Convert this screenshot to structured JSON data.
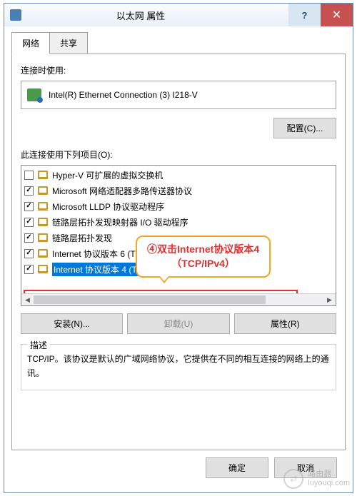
{
  "window": {
    "title": "以太网 属性",
    "help_symbol": "?",
    "close_symbol": "✕"
  },
  "tabs": {
    "active": "网络",
    "inactive": "共享"
  },
  "section": {
    "connect_with_label": "连接时使用:",
    "adapter_name": "Intel(R) Ethernet Connection (3) I218-V",
    "configure_btn": "配置(C)...",
    "items_label": "此连接使用下列项目(O):"
  },
  "list": [
    {
      "checked": false,
      "text": "Hyper-V 可扩展的虚拟交换机",
      "selected": false
    },
    {
      "checked": true,
      "text": "Microsoft 网络适配器多路传送器协议",
      "selected": false
    },
    {
      "checked": true,
      "text": "Microsoft LLDP 协议驱动程序",
      "selected": false
    },
    {
      "checked": true,
      "text": "链路层拓扑发现映射器 I/O 驱动程序",
      "selected": false
    },
    {
      "checked": true,
      "text": "链路层拓扑发现",
      "selected": false,
      "clipped": true
    },
    {
      "checked": true,
      "text": "Internet 协议版本 6 (TCP/IPv6)",
      "selected": false,
      "partial": true
    },
    {
      "checked": true,
      "text": "Internet 协议版本 4 (TCP/IPv4)",
      "selected": true
    }
  ],
  "buttons": {
    "install": "安装(N)...",
    "uninstall": "卸载(U)",
    "properties": "属性(R)"
  },
  "description": {
    "label": "描述",
    "text": "TCP/IP。该协议是默认的广域网络协议，它提供在不同的相互连接的网络上的通讯。"
  },
  "footer": {
    "ok": "确定",
    "cancel": "取消"
  },
  "callout": {
    "line1": "④双击Internet协议版本4",
    "line2": "（TCP/IPv4）"
  },
  "watermark": {
    "brand": "路由器",
    "url": "luyouqi.com"
  }
}
